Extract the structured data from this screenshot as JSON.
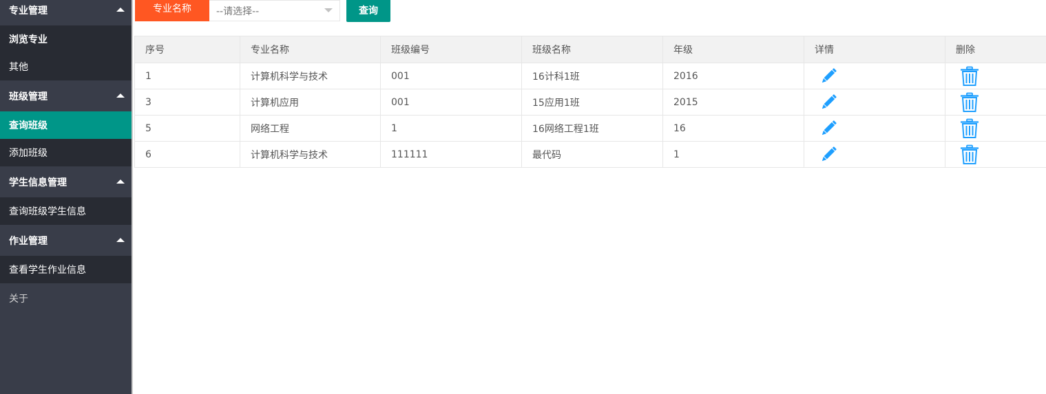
{
  "sidebar": {
    "groups": [
      {
        "label": "专业管理",
        "items": [
          {
            "label": "浏览专业"
          },
          {
            "label": "其他"
          }
        ]
      },
      {
        "label": "班级管理",
        "items": [
          {
            "label": "查询班级",
            "active": true
          },
          {
            "label": "添加班级"
          }
        ]
      },
      {
        "label": "学生信息管理",
        "items": [
          {
            "label": "查询班级学生信息"
          }
        ]
      },
      {
        "label": "作业管理",
        "items": [
          {
            "label": "查看学生作业信息"
          }
        ]
      }
    ],
    "footer_item": {
      "label": "关于"
    }
  },
  "toolbar": {
    "field_label": "专业名称",
    "select_value": "--请选择--",
    "query_label": "查询"
  },
  "table": {
    "headers": [
      "序号",
      "专业名称",
      "班级编号",
      "班级名称",
      "年级",
      "详情",
      "删除"
    ],
    "rows": [
      [
        "1",
        "计算机科学与技术",
        "001",
        "16计科1班",
        "2016"
      ],
      [
        "3",
        "计算机应用",
        "001",
        "15应用1班",
        "2015"
      ],
      [
        "5",
        "网络工程",
        "1",
        "16网络工程1班",
        "16"
      ],
      [
        "6",
        "计算机科学与技术",
        "111111",
        "最代码",
        "1"
      ]
    ],
    "icons": {
      "detail": "pencil-icon",
      "delete": "trash-icon"
    }
  },
  "colors": {
    "sidebar_bg": "#393d49",
    "sidebar_item_bg": "#282b33",
    "accent": "#009688",
    "label_orange": "#ff5722",
    "icon_blue": "#1e9fff"
  }
}
